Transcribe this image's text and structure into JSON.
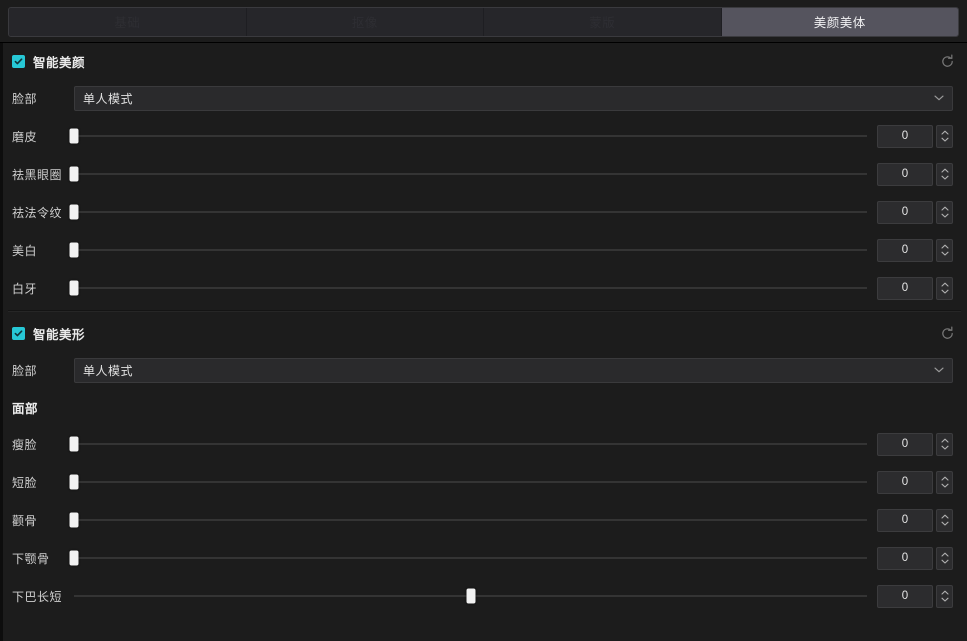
{
  "theme": {
    "bg": "#1c1c1c",
    "accent": "#27c8d6",
    "active_tab_bg": "#55545e",
    "field_bg": "#2a2a2c"
  },
  "tabs": [
    {
      "label": "基础",
      "active": false
    },
    {
      "label": "抠像",
      "active": false
    },
    {
      "label": "蒙版",
      "active": false
    },
    {
      "label": "美颜美体",
      "active": true
    }
  ],
  "sections": [
    {
      "title": "智能美颜",
      "checked": true,
      "reset_icon": "reset-icon",
      "face_row": {
        "label": "脸部",
        "value": "单人模式",
        "arrow_icon": "chevron-down-icon"
      },
      "sliders": [
        {
          "label": "磨皮",
          "value": "0",
          "percent": 0
        },
        {
          "label": "祛黑眼圈",
          "value": "0",
          "percent": 0
        },
        {
          "label": "祛法令纹",
          "value": "0",
          "percent": 0
        },
        {
          "label": "美白",
          "value": "0",
          "percent": 0
        },
        {
          "label": "白牙",
          "value": "0",
          "percent": 0
        }
      ]
    },
    {
      "title": "智能美形",
      "checked": true,
      "reset_icon": "reset-icon",
      "face_row": {
        "label": "脸部",
        "value": "单人模式",
        "arrow_icon": "chevron-down-icon"
      },
      "subheader": "面部",
      "sliders": [
        {
          "label": "瘦脸",
          "value": "0",
          "percent": 0
        },
        {
          "label": "短脸",
          "value": "0",
          "percent": 0
        },
        {
          "label": "颧骨",
          "value": "0",
          "percent": 0
        },
        {
          "label": "下颚骨",
          "value": "0",
          "percent": 0
        },
        {
          "label": "下巴长短",
          "value": "0",
          "percent": 50
        }
      ]
    }
  ]
}
